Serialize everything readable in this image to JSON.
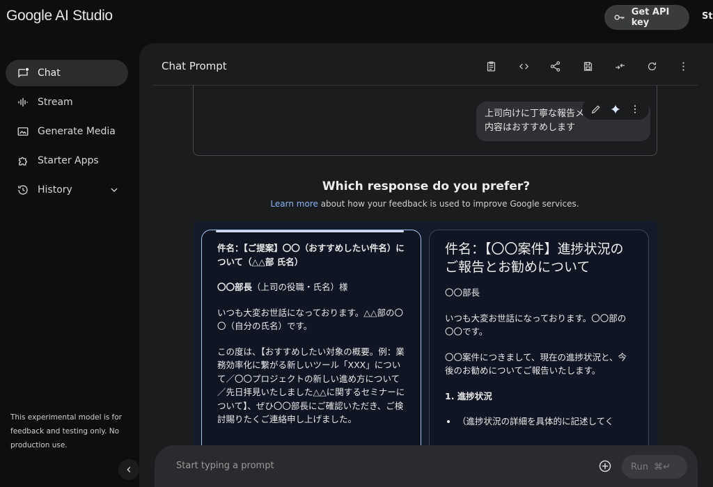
{
  "header": {
    "logo": "Google AI Studio",
    "api_key_label": "Get API key",
    "truncated_label": "Str"
  },
  "sidebar": {
    "items": [
      {
        "label": "Chat",
        "icon": "chat-icon"
      },
      {
        "label": "Stream",
        "icon": "waveform-icon"
      },
      {
        "label": "Generate Media",
        "icon": "image-icon"
      },
      {
        "label": "Starter Apps",
        "icon": "puzzle-icon"
      },
      {
        "label": "History",
        "icon": "history-icon"
      }
    ],
    "disclaimer": "This experimental model is for feedback and testing only. No production use."
  },
  "panel": {
    "title": "Chat Prompt",
    "toolbar_icons": [
      "clipboard-icon",
      "code-icon",
      "share-icon",
      "save-icon",
      "compare-icon",
      "refresh-icon",
      "more-vert-icon"
    ]
  },
  "user_message": {
    "line1": "上司向けに丁寧な報告メ",
    "line2": "内容はおすすめします"
  },
  "preference": {
    "title": "Which response do you prefer?",
    "link": "Learn more",
    "subtitle_rest": " about how your feedback is used to improve Google services."
  },
  "response_a": {
    "subject": "件名：【ご提案】〇〇（おすすめしたい件名）について（△△部 氏名）",
    "greeting_name": "〇〇部長",
    "greeting_rest": "（上司の役職・氏名）様",
    "p1": "いつも大変お世話になっております。△△部の〇〇（自分の氏名）です。",
    "p2": "この度は、【おすすめしたい対象の概要。例：業務効率化に繋がる新しいツール「XXX」について／〇〇プロジェクトの新しい進め方について／先日拝見いたしました△△に関するセミナーについて】、ぜひ〇〇部長にご確認いただき、ご検討賜りたくご連絡申し上げました。"
  },
  "response_b": {
    "title": "件名：【〇〇案件】進捗状況のご報告とお勧めについて",
    "p1": "〇〇部長",
    "p2": "いつも大変お世話になっております。〇〇部の〇〇です。",
    "p3": "〇〇案件につきまして、現在の進捗状況と、今後のお勧めについてご報告いたします。",
    "h1": "1. 進捗状況",
    "li1": "（進捗状況の詳細を具体的に記述してく"
  },
  "input": {
    "placeholder": "Start typing a prompt",
    "run_label": "Run",
    "shortcut": "⌘↵"
  }
}
